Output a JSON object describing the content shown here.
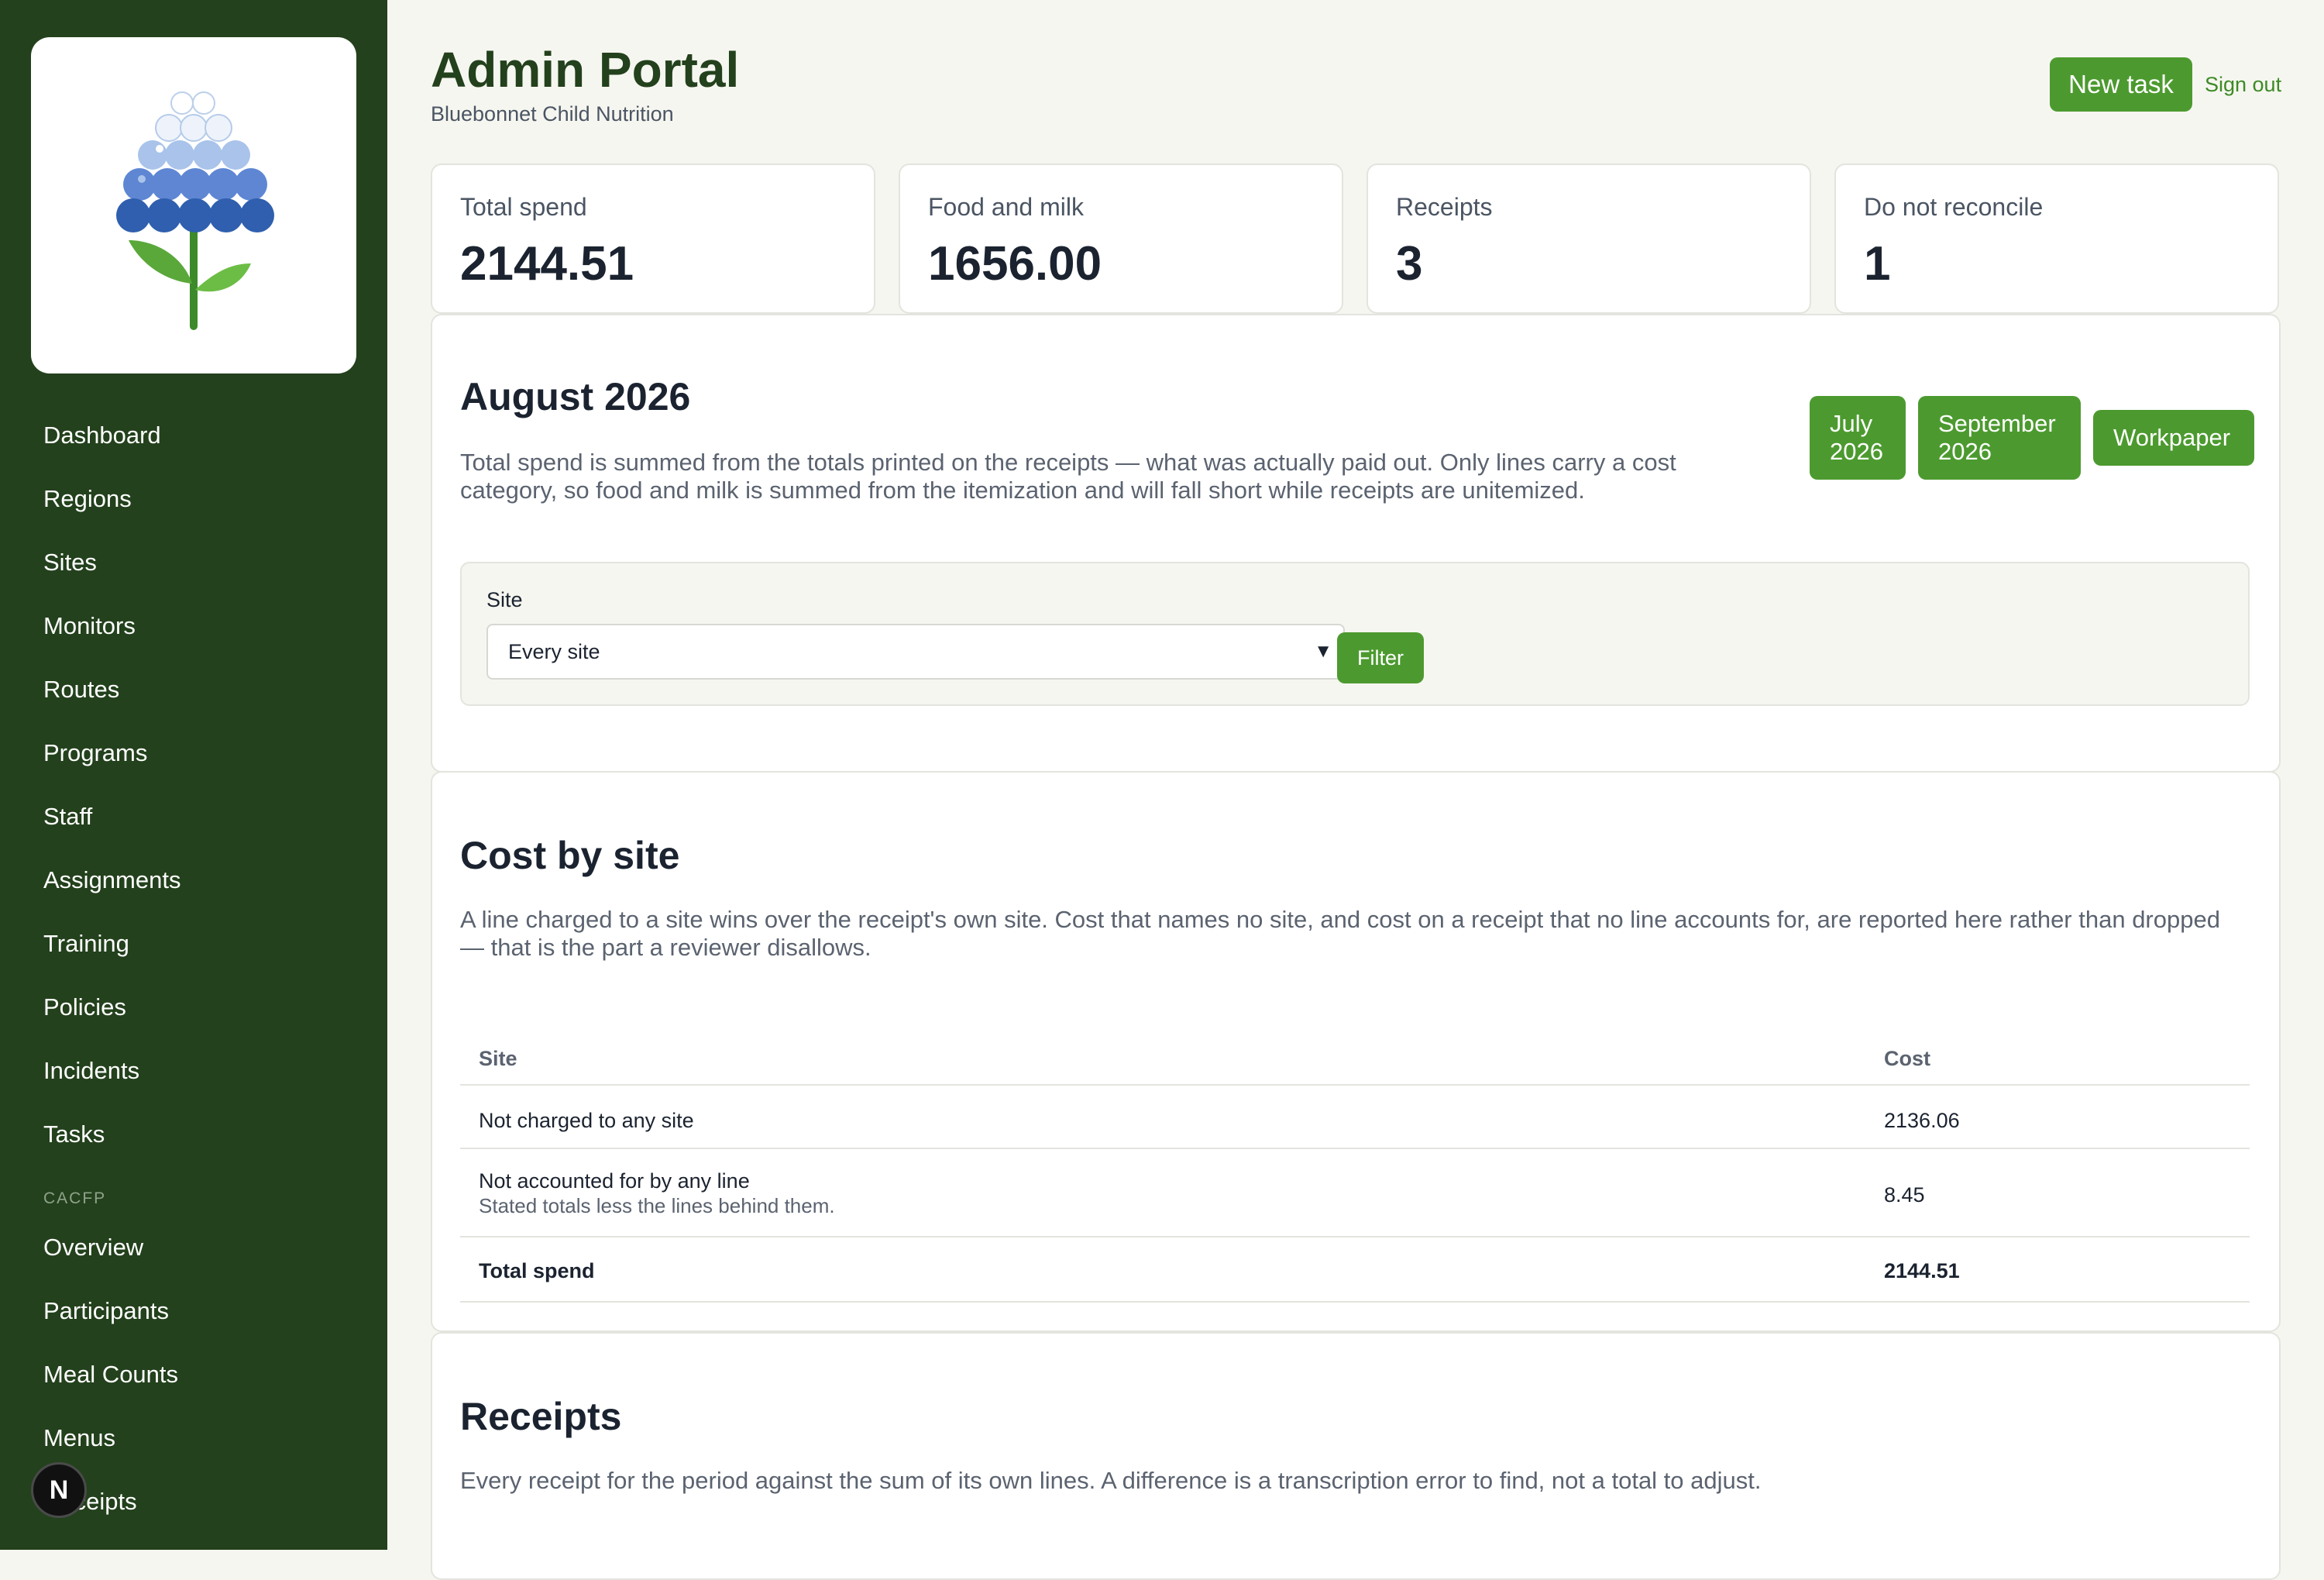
{
  "sidebar": {
    "items": [
      {
        "label": "Dashboard"
      },
      {
        "label": "Regions"
      },
      {
        "label": "Sites"
      },
      {
        "label": "Monitors"
      },
      {
        "label": "Routes"
      },
      {
        "label": "Programs"
      },
      {
        "label": "Staff"
      },
      {
        "label": "Assignments"
      },
      {
        "label": "Training"
      },
      {
        "label": "Policies"
      },
      {
        "label": "Incidents"
      },
      {
        "label": "Tasks"
      }
    ],
    "section_label": "CACFP",
    "section_items": [
      {
        "label": "Overview"
      },
      {
        "label": "Participants"
      },
      {
        "label": "Meal Counts"
      },
      {
        "label": "Menus"
      },
      {
        "label": "Receipts"
      }
    ],
    "badge_letter": "N"
  },
  "header": {
    "title": "Admin Portal",
    "subtitle": "Bluebonnet Child Nutrition",
    "new_task_label": "New task",
    "sign_out_label": "Sign out"
  },
  "stats": [
    {
      "label": "Total spend",
      "value": "2144.51"
    },
    {
      "label": "Food and milk",
      "value": "1656.00"
    },
    {
      "label": "Receipts",
      "value": "3"
    },
    {
      "label": "Do not reconcile",
      "value": "1"
    }
  ],
  "period": {
    "title": "August 2026",
    "description": "Total spend is summed from the totals printed on the receipts — what was actually paid out. Only lines carry a cost category, so food and milk is summed from the itemization and will fall short while receipts are unitemized.",
    "prev_label": "July 2026",
    "next_label": "September 2026",
    "workpaper_label": "Workpaper",
    "filter": {
      "label": "Site",
      "selected": "Every site",
      "button_label": "Filter"
    }
  },
  "cost_by_site": {
    "title": "Cost by site",
    "description": "A line charged to a site wins over the receipt's own site. Cost that names no site, and cost on a receipt that no line accounts for, are reported here rather than dropped — that is the part a reviewer disallows.",
    "columns": [
      "Site",
      "Cost"
    ],
    "rows": [
      {
        "site": "Not charged to any site",
        "note": "",
        "cost": "2136.06"
      },
      {
        "site": "Not accounted for by any line",
        "note": "Stated totals less the lines behind them.",
        "cost": "8.45"
      }
    ],
    "total": {
      "label": "Total spend",
      "cost": "2144.51"
    }
  },
  "receipts": {
    "title": "Receipts",
    "description": "Every receipt for the period against the sum of its own lines. A difference is a transcription error to find, not a total to adjust."
  },
  "colors": {
    "sidebar": "#23411c",
    "accent": "#4c9a2f",
    "page": "#f6f6f0"
  }
}
